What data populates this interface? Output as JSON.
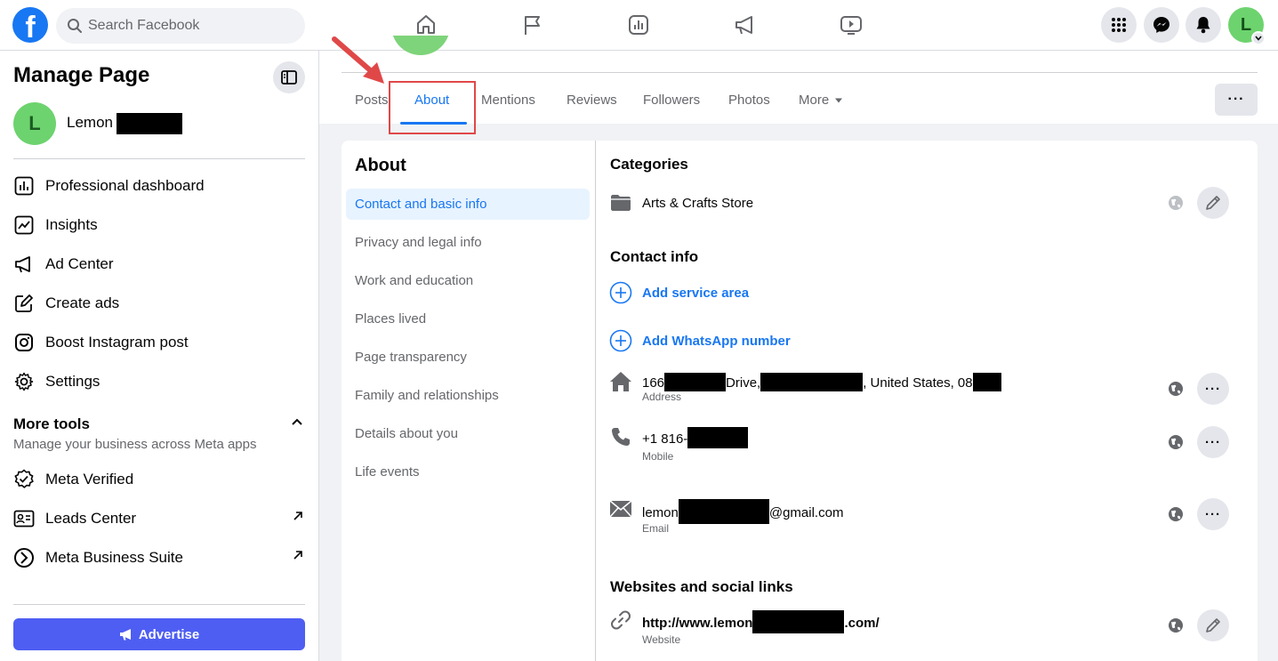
{
  "topbar": {
    "logo": "f",
    "search_placeholder": "Search Facebook",
    "nav_icons": [
      "home-icon",
      "flag-icon",
      "insights-icon",
      "megaphone-icon",
      "video-icon"
    ],
    "right_icons": [
      "menu-grid-icon",
      "messenger-icon",
      "bell-icon"
    ],
    "avatar_letter": "L"
  },
  "sidebar": {
    "title": "Manage Page",
    "page_avatar_letter": "L",
    "page_name": "Lemon",
    "items": [
      {
        "label": "Professional dashboard",
        "icon": "dashboard-icon"
      },
      {
        "label": "Insights",
        "icon": "insights-icon"
      },
      {
        "label": "Ad Center",
        "icon": "megaphone-icon"
      },
      {
        "label": "Create ads",
        "icon": "edit-icon"
      },
      {
        "label": "Boost Instagram post",
        "icon": "instagram-icon"
      },
      {
        "label": "Settings",
        "icon": "gear-icon"
      }
    ],
    "more_tools": {
      "title": "More tools",
      "subtitle": "Manage your business across Meta apps",
      "items": [
        {
          "label": "Meta Verified",
          "icon": "verified-icon"
        },
        {
          "label": "Leads Center",
          "icon": "leads-icon"
        },
        {
          "label": "Meta Business Suite",
          "icon": "business-suite-icon"
        }
      ]
    },
    "advertise_label": "Advertise"
  },
  "tabs": {
    "items": [
      "Posts",
      "About",
      "Mentions",
      "Reviews",
      "Followers",
      "Photos"
    ],
    "active": "About",
    "more_label": "More",
    "options_label": "···"
  },
  "about": {
    "title": "About",
    "nav": [
      "Contact and basic info",
      "Privacy and legal info",
      "Work and education",
      "Places lived",
      "Page transparency",
      "Family and relationships",
      "Details about you",
      "Life events"
    ],
    "active_nav": "Contact and basic info",
    "categories": {
      "title": "Categories",
      "value": "Arts & Crafts Store"
    },
    "contact": {
      "title": "Contact info",
      "add_service_area": "Add service area",
      "add_whatsapp": "Add WhatsApp number",
      "address": {
        "part1": "166",
        "part2": "Drive,",
        "part3": ", United States, 08",
        "label": "Address"
      },
      "phone": {
        "value": "+1 816-",
        "label": "Mobile"
      },
      "email": {
        "part1": "lemon",
        "part2": "@gmail.com",
        "label": "Email"
      }
    },
    "websites": {
      "title": "Websites and social links",
      "part1": "http://www.lemon",
      "part2": ".com/",
      "label": "Website"
    },
    "more_btn": "···"
  },
  "colors": {
    "accent": "#1877f2",
    "advertise": "#4e5ef2",
    "highlight_box": "#e04848"
  }
}
